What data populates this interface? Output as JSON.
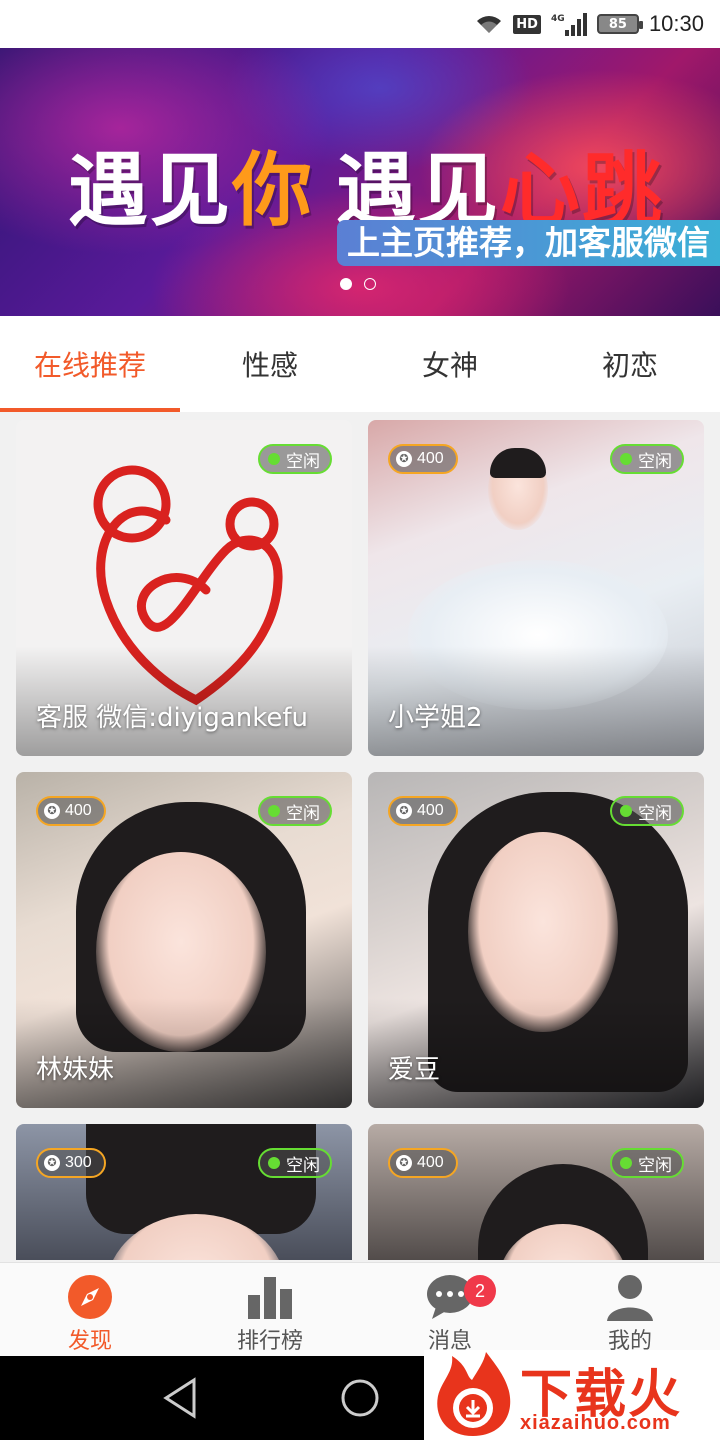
{
  "status_bar": {
    "network": "HD",
    "signal": "4G",
    "battery": "85",
    "time": "10:30"
  },
  "banner": {
    "title_part1": "遇见",
    "title_part2": "你",
    "title_part3": "遇见",
    "title_part4": "心跳",
    "subtitle": "上主页推荐，加客服微信",
    "page_count": 2,
    "current_page": 1
  },
  "tabs": [
    {
      "label": "在线推荐",
      "active": true
    },
    {
      "label": "性感",
      "active": false
    },
    {
      "label": "女神",
      "active": false
    },
    {
      "label": "初恋",
      "active": false
    }
  ],
  "cards": [
    {
      "name": "客服 微信:diyigankefu",
      "status": "空闲",
      "coins": null
    },
    {
      "name": "小学姐2",
      "status": "空闲",
      "coins": "400"
    },
    {
      "name": "林妹妹",
      "status": "空闲",
      "coins": "400"
    },
    {
      "name": "爱豆",
      "status": "空闲",
      "coins": "400"
    },
    {
      "name": "",
      "status": "空闲",
      "coins": "300"
    },
    {
      "name": "",
      "status": "空闲",
      "coins": "400"
    }
  ],
  "bottom_nav": [
    {
      "label": "发现",
      "icon": "compass-icon",
      "active": true
    },
    {
      "label": "排行榜",
      "icon": "bar-chart-icon",
      "active": false
    },
    {
      "label": "消息",
      "icon": "chat-bubble-icon",
      "active": false,
      "badge": "2"
    },
    {
      "label": "我的",
      "icon": "person-icon",
      "active": false
    }
  ],
  "watermark": {
    "text": "下载火",
    "url": "xiazaihuo.com"
  },
  "colors": {
    "accent": "#f25a2a",
    "status_green": "#66dd33",
    "coin_orange": "#f5a623",
    "badge_red": "#f0394a"
  }
}
